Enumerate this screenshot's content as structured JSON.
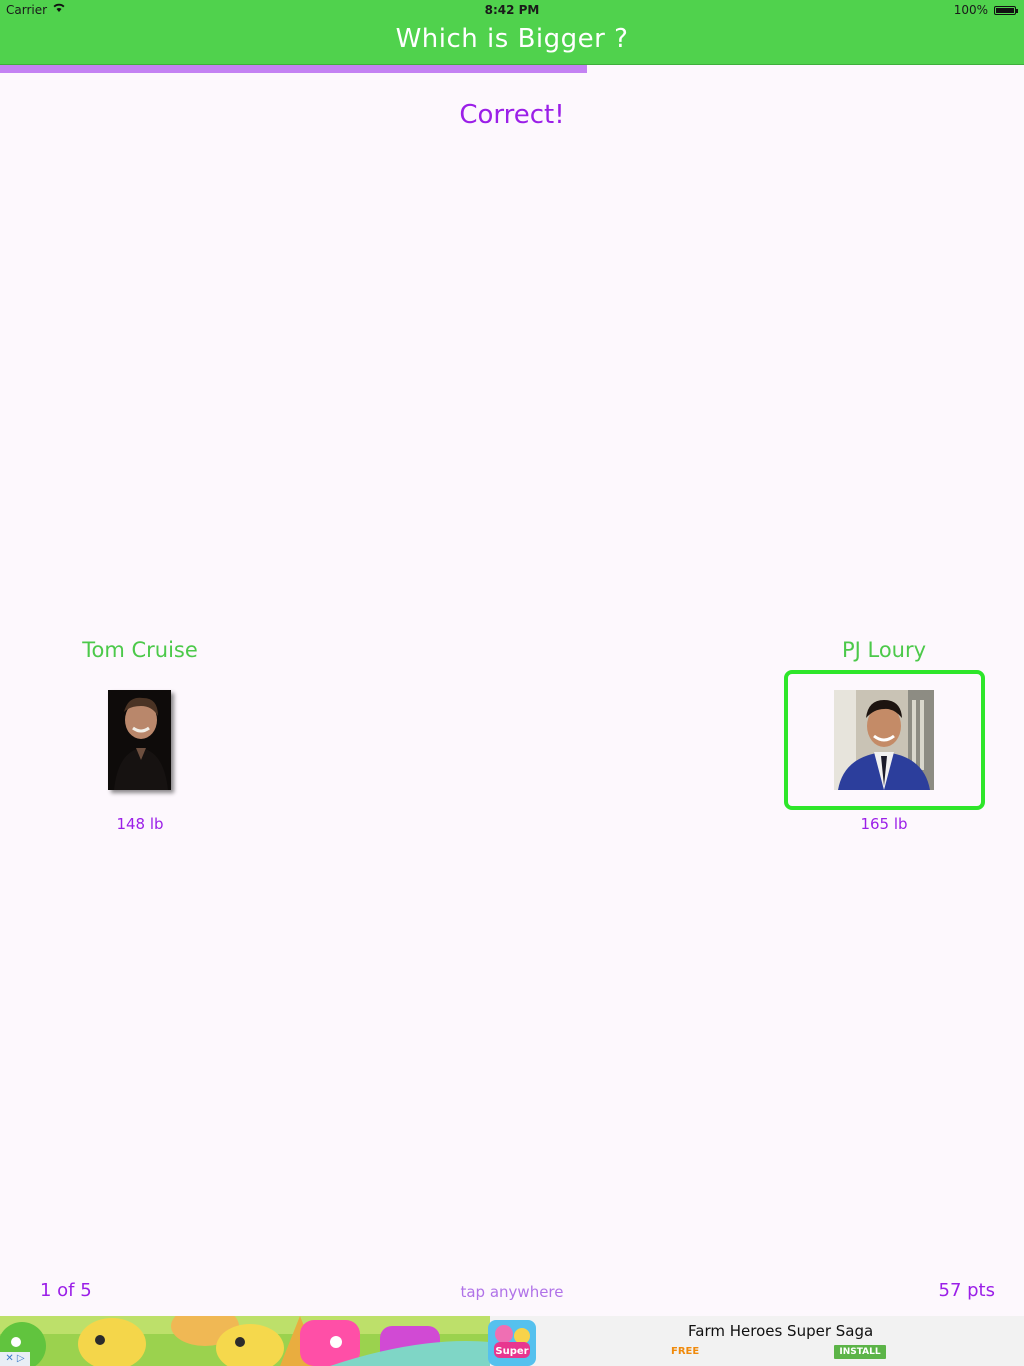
{
  "status_bar": {
    "carrier": "Carrier",
    "time": "8:42 PM",
    "battery": "100%"
  },
  "nav": {
    "title": "Which is Bigger ?"
  },
  "progress": {
    "fraction": 0.573
  },
  "result": "Correct!",
  "left_person": {
    "name": "Tom Cruise",
    "weight": "148 lb"
  },
  "right_person": {
    "name": "PJ Loury",
    "weight": "165 lb",
    "selected": true
  },
  "footer": {
    "question_count": "1 of 5",
    "hint": "tap anywhere",
    "score": "57 pts"
  },
  "ad": {
    "app_name": "Farm Heroes Super Saga",
    "price": "FREE",
    "install": "INSTALL",
    "choices": "✕ ▷"
  },
  "colors": {
    "nav": "#50d24d",
    "accent_purple": "#9b1fe8",
    "name_green": "#4cc94a",
    "selected_border": "#2ee62a",
    "progress": "#c482f3"
  }
}
